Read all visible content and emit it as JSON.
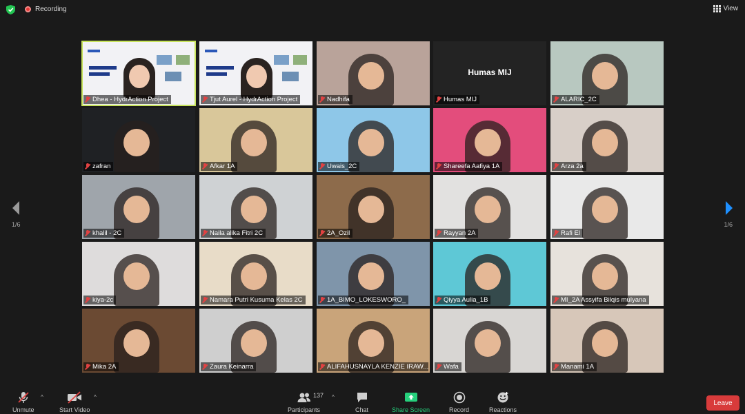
{
  "top": {
    "recording_label": "Recording",
    "view_label": "View"
  },
  "pager": {
    "left": "1/6",
    "right": "1/6"
  },
  "participants": [
    {
      "name": "Dhea - HydrAction Project",
      "row": 0,
      "col": 0,
      "bg": "#f2f2f5",
      "active": true,
      "kind": "slide"
    },
    {
      "name": "Tjut Aurel - HydrAction Project",
      "row": 0,
      "col": 1,
      "bg": "#f2f2f5",
      "kind": "slide"
    },
    {
      "name": "Nadhifa",
      "row": 0,
      "col": 2,
      "bg": "#b9a39a",
      "kind": "cam"
    },
    {
      "name": "Humas MIJ",
      "row": 0,
      "col": 3,
      "bg": "#232323",
      "kind": "nocam"
    },
    {
      "name": "ALARIC_2C",
      "row": 0,
      "col": 4,
      "bg": "#b8c8c0",
      "kind": "cam"
    },
    {
      "name": "zafran",
      "row": 1,
      "col": 0,
      "bg": "#1f2124",
      "kind": "cam"
    },
    {
      "name": "Afkar 1A",
      "row": 1,
      "col": 1,
      "bg": "#d9c79a",
      "kind": "cam"
    },
    {
      "name": "Uwais_2C",
      "row": 1,
      "col": 2,
      "bg": "#8ec7e8",
      "kind": "cam"
    },
    {
      "name": "Shareefa Aafiya 1A",
      "row": 1,
      "col": 3,
      "bg": "#e34d7c",
      "kind": "cam"
    },
    {
      "name": "Arza 2a",
      "row": 1,
      "col": 4,
      "bg": "#d8cfc8",
      "kind": "cam"
    },
    {
      "name": "khalil - 2C",
      "row": 2,
      "col": 0,
      "bg": "#9fa5ab",
      "kind": "cam"
    },
    {
      "name": "Naila alika Fitri 2C",
      "row": 2,
      "col": 1,
      "bg": "#cfd2d4",
      "kind": "cam"
    },
    {
      "name": "2A_Ozil",
      "row": 2,
      "col": 2,
      "bg": "#8d6b4b",
      "kind": "cam"
    },
    {
      "name": "Rayyan 2A",
      "row": 2,
      "col": 3,
      "bg": "#e2e1e0",
      "kind": "cam"
    },
    {
      "name": "Rafi El",
      "row": 2,
      "col": 4,
      "bg": "#e9e9e9",
      "kind": "cam"
    },
    {
      "name": "kiya-2c",
      "row": 3,
      "col": 0,
      "bg": "#dedcdc",
      "kind": "cam"
    },
    {
      "name": "Namara Putri Kusuma Kelas 2C",
      "row": 3,
      "col": 1,
      "bg": "#e8dcc8",
      "kind": "cam"
    },
    {
      "name": "1A_BIMO_LOKESWORO_",
      "row": 3,
      "col": 2,
      "bg": "#7f95aa",
      "kind": "cam"
    },
    {
      "name": "Qiyya Aulia_1B",
      "row": 3,
      "col": 3,
      "bg": "#5ec8d6",
      "kind": "cam"
    },
    {
      "name": "MI_2A Assyifa Bilqis mulyana",
      "row": 3,
      "col": 4,
      "bg": "#e7e2dc",
      "kind": "cam"
    },
    {
      "name": "Mika 2A",
      "row": 4,
      "col": 0,
      "bg": "#6b4a33",
      "kind": "cam"
    },
    {
      "name": "Zaura Keinarra",
      "row": 4,
      "col": 1,
      "bg": "#cfcfcf",
      "kind": "cam"
    },
    {
      "name": "ALIFAHUSNAYLA KENZIE IRAW...",
      "row": 4,
      "col": 2,
      "bg": "#c9a47a",
      "kind": "cam"
    },
    {
      "name": "Wafa",
      "row": 4,
      "col": 3,
      "bg": "#d8d6d3",
      "kind": "cam"
    },
    {
      "name": "Manami 1A",
      "row": 4,
      "col": 4,
      "bg": "#d7c7b9",
      "kind": "cam"
    }
  ],
  "toolbar": {
    "unmute": "Unmute",
    "start_video": "Start Video",
    "participants": "Participants",
    "participant_count": "137",
    "chat": "Chat",
    "share_screen": "Share Screen",
    "record": "Record",
    "reactions": "Reactions",
    "leave": "Leave"
  },
  "colors": {
    "accent_green": "#26d07c",
    "leave_red": "#d83b3b",
    "active_outline": "#c7e35b",
    "pager_blue": "#1e90ff"
  }
}
